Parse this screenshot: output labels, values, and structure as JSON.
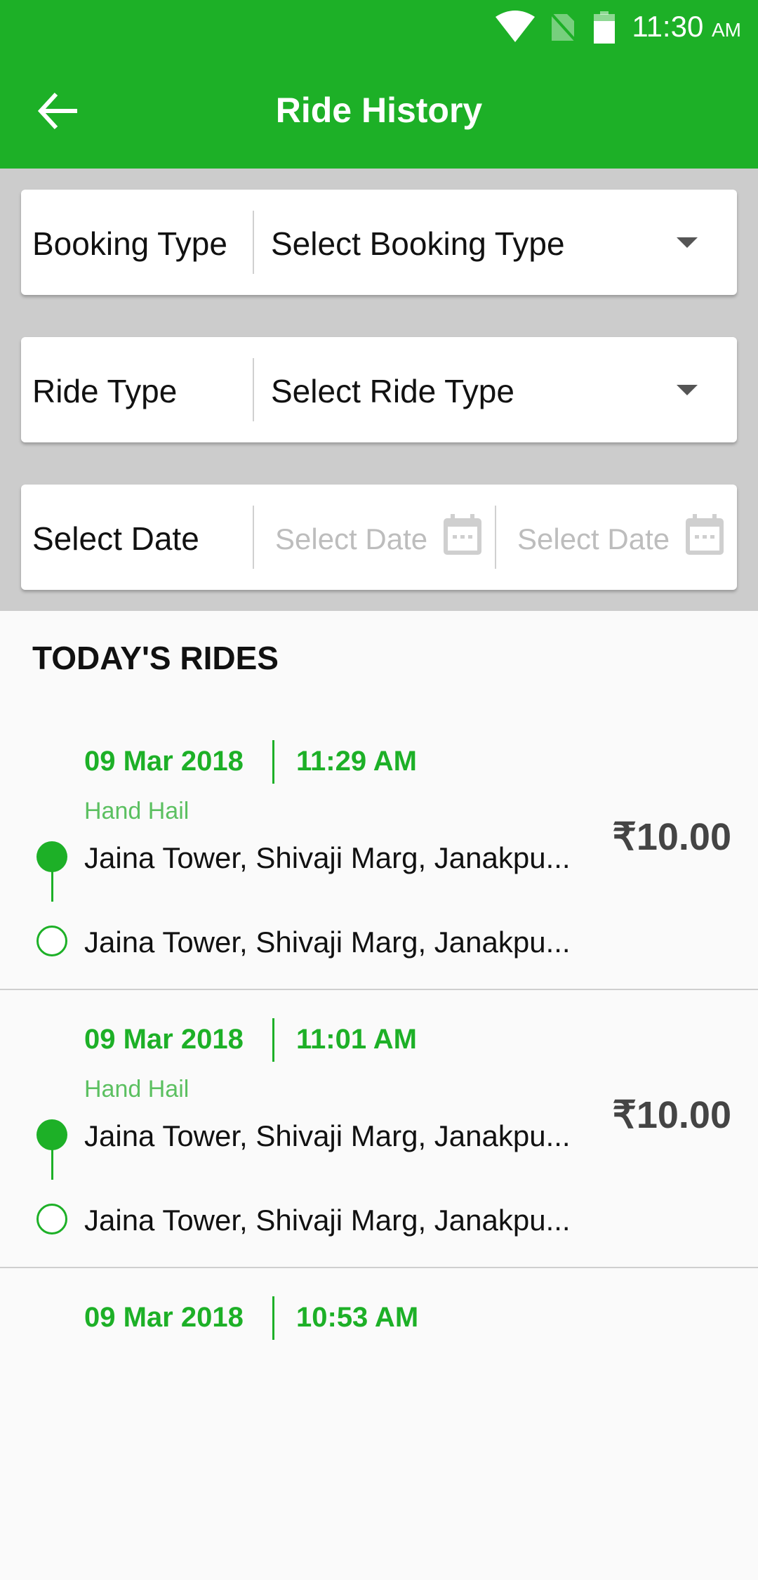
{
  "status_bar": {
    "time": "11:30",
    "ampm": "AM",
    "icons": [
      "wifi-icon",
      "no-sim-icon",
      "battery-icon"
    ]
  },
  "app_bar": {
    "back_icon": "arrow-left-icon",
    "title": "Ride History"
  },
  "filters": {
    "booking_type": {
      "label": "Booking Type",
      "value": "Select Booking Type"
    },
    "ride_type": {
      "label": "Ride Type",
      "value": "Select Ride Type"
    },
    "date": {
      "label": "Select Date",
      "from_placeholder": "Select Date",
      "to_placeholder": "Select Date"
    }
  },
  "section_title": "TODAY'S RIDES",
  "rides": [
    {
      "date": "09 Mar 2018",
      "time": "11:29 AM",
      "kind": "Hand Hail",
      "pickup": "Jaina Tower, Shivaji Marg, Janakpu...",
      "drop": "Jaina Tower, Shivaji Marg, Janakpu...",
      "fare": "₹10.00"
    },
    {
      "date": "09 Mar 2018",
      "time": "11:01 AM",
      "kind": "Hand Hail",
      "pickup": "Jaina Tower, Shivaji Marg, Janakpu...",
      "drop": "Jaina Tower, Shivaji Marg, Janakpu...",
      "fare": "₹10.00"
    },
    {
      "date": "09 Mar 2018",
      "time": "10:53 AM"
    }
  ],
  "colors": {
    "primary": "#1db027",
    "filter_bg": "#cccccc",
    "fare": "#444444"
  }
}
